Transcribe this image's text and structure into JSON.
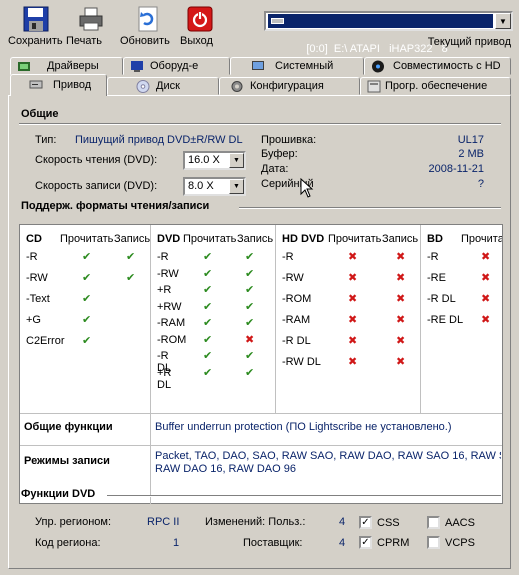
{
  "toolbar": {
    "save": "Сохранить",
    "print": "Печать",
    "refresh": "Обновить",
    "exit": "Выход",
    "drive_value": "[0:0]  E:\\ ATAPI   iHAP322   8",
    "current_drive_label": "Текущий привод"
  },
  "tabs": {
    "row1": [
      "Драйверы",
      "Оборуд-е",
      "Системный",
      "Совместимость с HD"
    ],
    "row2": [
      "Привод",
      "Диск",
      "Конфигурация",
      "Прогр. обеспечение"
    ]
  },
  "general": {
    "title": "Общие",
    "type_label": "Тип:",
    "type_value": "Пишущий привод DVD±R/RW DL",
    "read_speed_label": "Скорость чтения (DVD):",
    "read_speed_value": "16.0 X",
    "write_speed_label": "Скорость записи (DVD):",
    "write_speed_value": "8.0 X",
    "firmware_label": "Прошивка:",
    "firmware_value": "UL17",
    "buffer_label": "Буфер:",
    "buffer_value": "2 MB",
    "date_label": "Дата:",
    "date_value": "2008-11-21",
    "serial_label": "Серийный",
    "serial_value": "?"
  },
  "formats": {
    "title": "Поддерж. форматы чтения/записи",
    "read_col": "Прочитать",
    "write_col": "Запись",
    "cd": {
      "name": "CD",
      "rows": [
        {
          "name": "-R",
          "read": true,
          "write": true
        },
        {
          "name": "-RW",
          "read": true,
          "write": true
        },
        {
          "name": "-Text",
          "read": true,
          "write": null
        },
        {
          "name": "+G",
          "read": true,
          "write": null
        },
        {
          "name": "C2Error",
          "read": true,
          "write": null
        }
      ]
    },
    "dvd": {
      "name": "DVD",
      "rows": [
        {
          "name": "-R",
          "read": true,
          "write": true
        },
        {
          "name": "-RW",
          "read": true,
          "write": true
        },
        {
          "name": "+R",
          "read": true,
          "write": true
        },
        {
          "name": "+RW",
          "read": true,
          "write": true
        },
        {
          "name": "-RAM",
          "read": true,
          "write": true
        },
        {
          "name": "-ROM",
          "read": true,
          "write": false
        },
        {
          "name": "-R DL",
          "read": true,
          "write": true
        },
        {
          "name": "+R DL",
          "read": true,
          "write": true
        }
      ]
    },
    "hddvd": {
      "name": "HD DVD",
      "rows": [
        {
          "name": "-R",
          "read": false,
          "write": false
        },
        {
          "name": "-RW",
          "read": false,
          "write": false
        },
        {
          "name": "-ROM",
          "read": false,
          "write": false
        },
        {
          "name": "-RAM",
          "read": false,
          "write": false
        },
        {
          "name": "-R DL",
          "read": false,
          "write": false
        },
        {
          "name": "-RW DL",
          "read": false,
          "write": false
        }
      ]
    },
    "bd": {
      "name": "BD",
      "read_col": "Прочита",
      "rows": [
        {
          "name": "-R",
          "read": false
        },
        {
          "name": "-RE",
          "read": false
        },
        {
          "name": "-R DL",
          "read": false
        },
        {
          "name": "-RE DL",
          "read": false
        }
      ]
    },
    "common_label": "Общие функции",
    "common_value": "Buffer underrun protection (ПО Lightscribe не установлено.)",
    "modes_label": "Режимы записи",
    "modes_value": "Packet, TAO, DAO, SAO, RAW SAO, RAW DAO, RAW SAO 16, RAW SA\nRAW DAO 16, RAW DAO 96"
  },
  "dvd_functions": {
    "title": "Функции DVD",
    "region_mgmt_label": "Упр. регионом:",
    "region_mgmt_value": "RPC II",
    "region_code_label": "Код региона:",
    "region_code_value": "1",
    "changes_user_label": "Изменений: Польз.:",
    "changes_user_value": "4",
    "changes_vendor_label": "Поставщик:",
    "changes_vendor_value": "4",
    "css": {
      "label": "CSS",
      "checked": true
    },
    "aacs": {
      "label": "AACS",
      "checked": false
    },
    "cprm": {
      "label": "CPRM",
      "checked": true
    },
    "vcps": {
      "label": "VCPS",
      "checked": false
    }
  },
  "colors": {
    "background": "#d4d0c8",
    "value_blue": "#0a246a",
    "check_green": "#2b8a1e",
    "cross_red": "#d01818"
  }
}
